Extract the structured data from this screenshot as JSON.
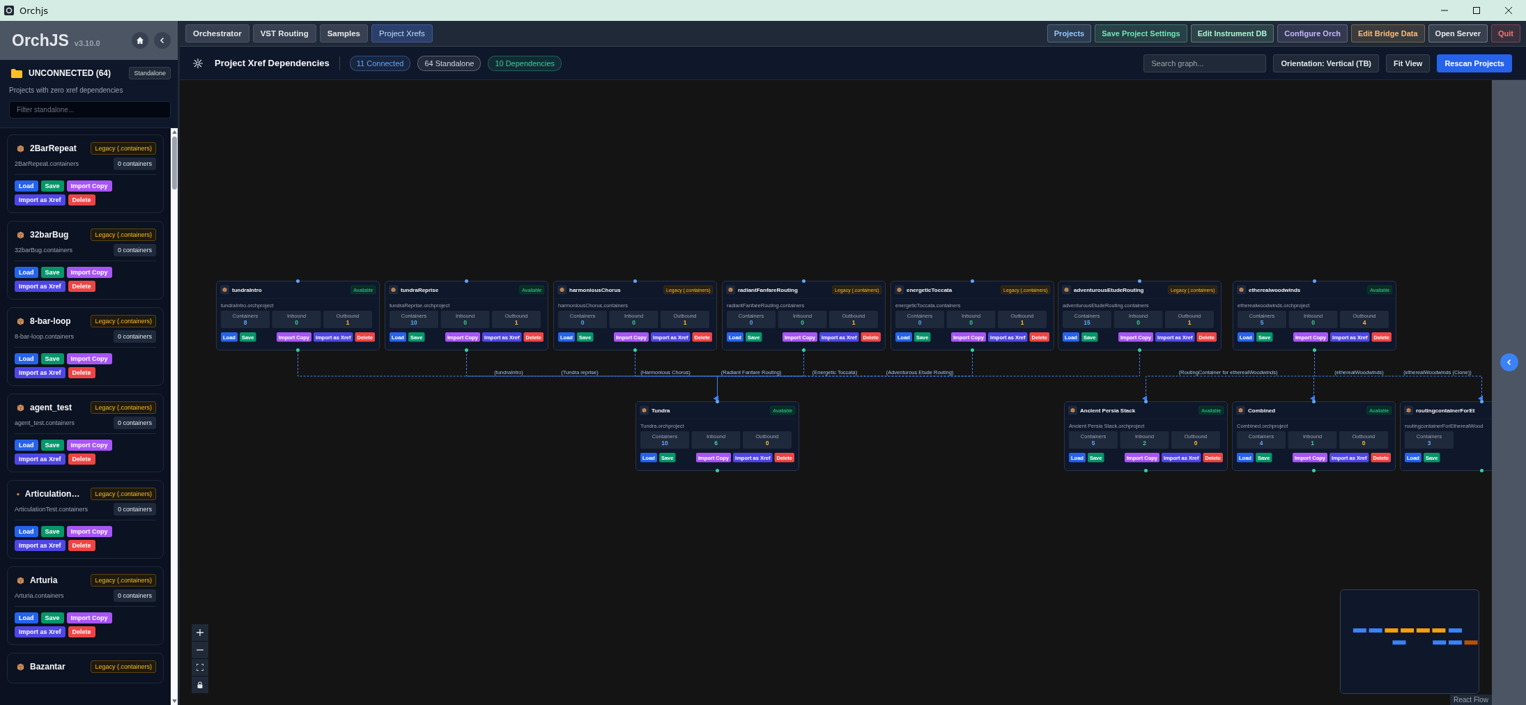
{
  "window": {
    "title": "Orchjs"
  },
  "sidebar": {
    "app_name": "OrchJS",
    "version": "v3.10.0",
    "section_title": "UNCONNECTED (64)",
    "section_tag": "Standalone",
    "description": "Projects with zero xref dependencies",
    "filter": {
      "placeholder": "Filter standalone..."
    },
    "projects": [
      {
        "name": "2BarRepeat",
        "badge": "Legacy (.containers)",
        "file": "2BarRepeat.containers",
        "count": "0 containers",
        "actions": [
          {
            "label": "Load",
            "kind": "load"
          },
          {
            "label": "Save",
            "kind": "save"
          },
          {
            "label": "Import Copy",
            "kind": "copy"
          },
          {
            "label": "Import as Xref",
            "kind": "xref"
          },
          {
            "label": "Delete",
            "kind": "delete"
          }
        ]
      },
      {
        "name": "32barBug",
        "badge": "Legacy (.containers)",
        "file": "32barBug.containers",
        "count": "0 containers",
        "actions": [
          {
            "label": "Load",
            "kind": "load"
          },
          {
            "label": "Save",
            "kind": "save"
          },
          {
            "label": "Import Copy",
            "kind": "copy"
          },
          {
            "label": "Import as Xref",
            "kind": "xref"
          },
          {
            "label": "Delete",
            "kind": "delete"
          }
        ]
      },
      {
        "name": "8-bar-loop",
        "badge": "Legacy (.containers)",
        "file": "8-bar-loop.containers",
        "count": "0 containers",
        "actions": [
          {
            "label": "Load",
            "kind": "load"
          },
          {
            "label": "Save",
            "kind": "save"
          },
          {
            "label": "Import Copy",
            "kind": "copy"
          },
          {
            "label": "Import as Xref",
            "kind": "xref"
          },
          {
            "label": "Delete",
            "kind": "delete"
          }
        ]
      },
      {
        "name": "agent_test",
        "badge": "Legacy (.containers)",
        "file": "agent_test.containers",
        "count": "0 containers",
        "actions": [
          {
            "label": "Load",
            "kind": "load"
          },
          {
            "label": "Save",
            "kind": "save"
          },
          {
            "label": "Import Copy",
            "kind": "copy"
          },
          {
            "label": "Import as Xref",
            "kind": "xref"
          },
          {
            "label": "Delete",
            "kind": "delete"
          }
        ]
      },
      {
        "name": "Articulation…",
        "badge": "Legacy (.containers)",
        "file": "ArticulationTest.containers",
        "count": "0 containers",
        "actions": [
          {
            "label": "Load",
            "kind": "load"
          },
          {
            "label": "Save",
            "kind": "save"
          },
          {
            "label": "Import Copy",
            "kind": "copy"
          },
          {
            "label": "Import as Xref",
            "kind": "xref"
          },
          {
            "label": "Delete",
            "kind": "delete"
          }
        ]
      },
      {
        "name": "Arturia",
        "badge": "Legacy (.containers)",
        "file": "Arturia.containers",
        "count": "0 containers",
        "actions": [
          {
            "label": "Load",
            "kind": "load"
          },
          {
            "label": "Save",
            "kind": "save"
          },
          {
            "label": "Import Copy",
            "kind": "copy"
          },
          {
            "label": "Import as Xref",
            "kind": "xref"
          },
          {
            "label": "Delete",
            "kind": "delete"
          }
        ]
      },
      {
        "name": "Bazantar",
        "badge": "Legacy (.containers)"
      }
    ]
  },
  "top_nav": {
    "tabs": [
      {
        "label": "Orchestrator",
        "selected": false
      },
      {
        "label": "VST Routing",
        "selected": false
      },
      {
        "label": "Samples",
        "selected": false
      },
      {
        "label": "Project Xrefs",
        "selected": true
      }
    ],
    "actions": [
      {
        "label": "Projects",
        "color": "#93c5fd"
      },
      {
        "label": "Save Project Settings",
        "color": "#6ee7b7"
      },
      {
        "label": "Edit Instrument DB",
        "color": "#a7f3d0"
      },
      {
        "label": "Configure Orch",
        "color": "#c4b5fd"
      },
      {
        "label": "Edit Bridge Data",
        "color": "#fdba74"
      },
      {
        "label": "Open Server",
        "color": "#e5e7eb"
      },
      {
        "label": "Quit",
        "color": "#f87171"
      }
    ]
  },
  "graph_header": {
    "title": "Project Xref Dependencies",
    "stats": [
      {
        "label": "11 Connected",
        "color": "#60a5fa"
      },
      {
        "label": "64 Standalone",
        "color": "#d1d5db"
      },
      {
        "label": "10 Dependencies",
        "color": "#34d399"
      }
    ],
    "search": {
      "placeholder": "Search graph..."
    },
    "buttons": [
      {
        "label": "Orientation: Vertical (TB)",
        "kind": "secondary"
      },
      {
        "label": "Fit View",
        "kind": "secondary"
      },
      {
        "label": "Rescan Projects",
        "kind": "primary"
      }
    ]
  },
  "graph": {
    "nodes": [
      {
        "name": "tundraIntro",
        "badge": {
          "text": "Available",
          "kind": "available"
        },
        "file": "tundraIntro.orchproject",
        "stats": [
          {
            "label": "Containers",
            "value": "8",
            "kind": "containers"
          },
          {
            "label": "Inbound",
            "value": "0",
            "kind": "inbound"
          },
          {
            "label": "Outbound",
            "value": "1",
            "kind": "outbound"
          }
        ],
        "actions": [
          {
            "label": "Load",
            "kind": "load"
          },
          {
            "label": "Save",
            "kind": "save"
          },
          {
            "label": "Import Copy",
            "kind": "copy"
          },
          {
            "label": "Import as Xref",
            "kind": "xref"
          },
          {
            "label": "Delete",
            "kind": "delete"
          }
        ]
      },
      {
        "name": "tundraReprise",
        "badge": {
          "text": "Available",
          "kind": "available"
        },
        "file": "tundraReprise.orchproject",
        "stats": [
          {
            "label": "Containers",
            "value": "10",
            "kind": "containers"
          },
          {
            "label": "Inbound",
            "value": "0",
            "kind": "inbound"
          },
          {
            "label": "Outbound",
            "value": "1",
            "kind": "outbound"
          }
        ],
        "actions": [
          {
            "label": "Load",
            "kind": "load"
          },
          {
            "label": "Save",
            "kind": "save"
          },
          {
            "label": "Import Copy",
            "kind": "copy"
          },
          {
            "label": "Import as Xref",
            "kind": "xref"
          },
          {
            "label": "Delete",
            "kind": "delete"
          }
        ]
      },
      {
        "name": "harmoniousChorus",
        "badge": {
          "text": "Legacy (.containers)",
          "kind": "legacy"
        },
        "file": "harmoniousChorus.containers",
        "stats": [
          {
            "label": "Containers",
            "value": "0",
            "kind": "containers"
          },
          {
            "label": "Inbound",
            "value": "0",
            "kind": "inbound"
          },
          {
            "label": "Outbound",
            "value": "1",
            "kind": "outbound"
          }
        ],
        "actions": [
          {
            "label": "Load",
            "kind": "load"
          },
          {
            "label": "Save",
            "kind": "save"
          },
          {
            "label": "Import Copy",
            "kind": "copy"
          },
          {
            "label": "Import as Xref",
            "kind": "xref"
          },
          {
            "label": "Delete",
            "kind": "delete"
          }
        ]
      },
      {
        "name": "radiantFanfareRouting",
        "badge": {
          "text": "Legacy (.containers)",
          "kind": "legacy"
        },
        "file": "radiantFanfareRouting.containers",
        "stats": [
          {
            "label": "Containers",
            "value": "0",
            "kind": "containers"
          },
          {
            "label": "Inbound",
            "value": "0",
            "kind": "inbound"
          },
          {
            "label": "Outbound",
            "value": "1",
            "kind": "outbound"
          }
        ],
        "actions": [
          {
            "label": "Load",
            "kind": "load"
          },
          {
            "label": "Save",
            "kind": "save"
          },
          {
            "label": "Import Copy",
            "kind": "copy"
          },
          {
            "label": "Import as Xref",
            "kind": "xref"
          },
          {
            "label": "Delete",
            "kind": "delete"
          }
        ]
      },
      {
        "name": "energeticToccata",
        "badge": {
          "text": "Legacy (.containers)",
          "kind": "legacy"
        },
        "file": "energeticToccata.containers",
        "stats": [
          {
            "label": "Containers",
            "value": "0",
            "kind": "containers"
          },
          {
            "label": "Inbound",
            "value": "0",
            "kind": "inbound"
          },
          {
            "label": "Outbound",
            "value": "1",
            "kind": "outbound"
          }
        ],
        "actions": [
          {
            "label": "Load",
            "kind": "load"
          },
          {
            "label": "Save",
            "kind": "save"
          },
          {
            "label": "Import Copy",
            "kind": "copy"
          },
          {
            "label": "Import as Xref",
            "kind": "xref"
          },
          {
            "label": "Delete",
            "kind": "delete"
          }
        ]
      },
      {
        "name": "adventurousEtudeRouting",
        "badge": {
          "text": "Legacy (.containers)",
          "kind": "legacy"
        },
        "file": "adventurousEtudeRouting.containers",
        "stats": [
          {
            "label": "Containers",
            "value": "15",
            "kind": "containers"
          },
          {
            "label": "Inbound",
            "value": "0",
            "kind": "inbound"
          },
          {
            "label": "Outbound",
            "value": "1",
            "kind": "outbound"
          }
        ],
        "actions": [
          {
            "label": "Load",
            "kind": "load"
          },
          {
            "label": "Save",
            "kind": "save"
          },
          {
            "label": "Import Copy",
            "kind": "copy"
          },
          {
            "label": "Import as Xref",
            "kind": "xref"
          },
          {
            "label": "Delete",
            "kind": "delete"
          }
        ]
      },
      {
        "name": "etherealwoodwinds",
        "badge": {
          "text": "Available",
          "kind": "available"
        },
        "file": "etherealwoodwinds.orchproject",
        "stats": [
          {
            "label": "Containers",
            "value": "5",
            "kind": "containers"
          },
          {
            "label": "Inbound",
            "value": "0",
            "kind": "inbound"
          },
          {
            "label": "Outbound",
            "value": "4",
            "kind": "outbound"
          }
        ],
        "actions": [
          {
            "label": "Load",
            "kind": "load"
          },
          {
            "label": "Save",
            "kind": "save"
          },
          {
            "label": "Import Copy",
            "kind": "copy"
          },
          {
            "label": "Import as Xref",
            "kind": "xref"
          },
          {
            "label": "Delete",
            "kind": "delete"
          }
        ]
      },
      {
        "name": "Tundra",
        "badge": {
          "text": "Available",
          "kind": "available"
        },
        "file": "Tundra.orchproject",
        "stats": [
          {
            "label": "Containers",
            "value": "10",
            "kind": "containers"
          },
          {
            "label": "Inbound",
            "value": "6",
            "kind": "inbound"
          },
          {
            "label": "Outbound",
            "value": "0",
            "kind": "outbound"
          }
        ],
        "actions": [
          {
            "label": "Load",
            "kind": "load"
          },
          {
            "label": "Save",
            "kind": "save"
          },
          {
            "label": "Import Copy",
            "kind": "copy"
          },
          {
            "label": "Import as Xref",
            "kind": "xref"
          },
          {
            "label": "Delete",
            "kind": "delete"
          }
        ]
      },
      {
        "name": "Ancient Persia Stack",
        "badge": {
          "text": "Available",
          "kind": "available"
        },
        "file": "Ancient Persia Stack.orchproject",
        "stats": [
          {
            "label": "Containers",
            "value": "5",
            "kind": "containers"
          },
          {
            "label": "Inbound",
            "value": "2",
            "kind": "inbound"
          },
          {
            "label": "Outbound",
            "value": "0",
            "kind": "outbound"
          }
        ],
        "actions": [
          {
            "label": "Load",
            "kind": "load"
          },
          {
            "label": "Save",
            "kind": "save"
          },
          {
            "label": "Import Copy",
            "kind": "copy"
          },
          {
            "label": "Import as Xref",
            "kind": "xref"
          },
          {
            "label": "Delete",
            "kind": "delete"
          }
        ]
      },
      {
        "name": "Combined",
        "badge": {
          "text": "Available",
          "kind": "available"
        },
        "file": "Combined.orchproject",
        "stats": [
          {
            "label": "Containers",
            "value": "4",
            "kind": "containers"
          },
          {
            "label": "Inbound",
            "value": "1",
            "kind": "inbound"
          },
          {
            "label": "Outbound",
            "value": "0",
            "kind": "outbound"
          }
        ],
        "actions": [
          {
            "label": "Load",
            "kind": "load"
          },
          {
            "label": "Save",
            "kind": "save"
          },
          {
            "label": "Import Copy",
            "kind": "copy"
          },
          {
            "label": "Import as Xref",
            "kind": "xref"
          },
          {
            "label": "Delete",
            "kind": "delete"
          }
        ]
      },
      {
        "name": "routingcontainerForEt",
        "file": "routingcontainerForEtherealWood",
        "stats": [
          {
            "label": "Containers",
            "value": "3",
            "kind": "containers"
          }
        ],
        "actions": [
          {
            "label": "Load",
            "kind": "load"
          },
          {
            "label": "Save",
            "kind": "save"
          }
        ]
      }
    ],
    "edge_labels": [
      "(tundraIntro)",
      "(Tundra reprise)",
      "(Harmonious Chorus)",
      "(Radiant Fanfare Routing)",
      "(Energetic Toccata)",
      "(Adventurous Etude Routing)",
      "(RoutingContainer for etherealWoodwinds)",
      "(etherealWoodwinds)",
      "(etherealWoodwinds (Clone))"
    ],
    "attribution": "React Flow"
  }
}
